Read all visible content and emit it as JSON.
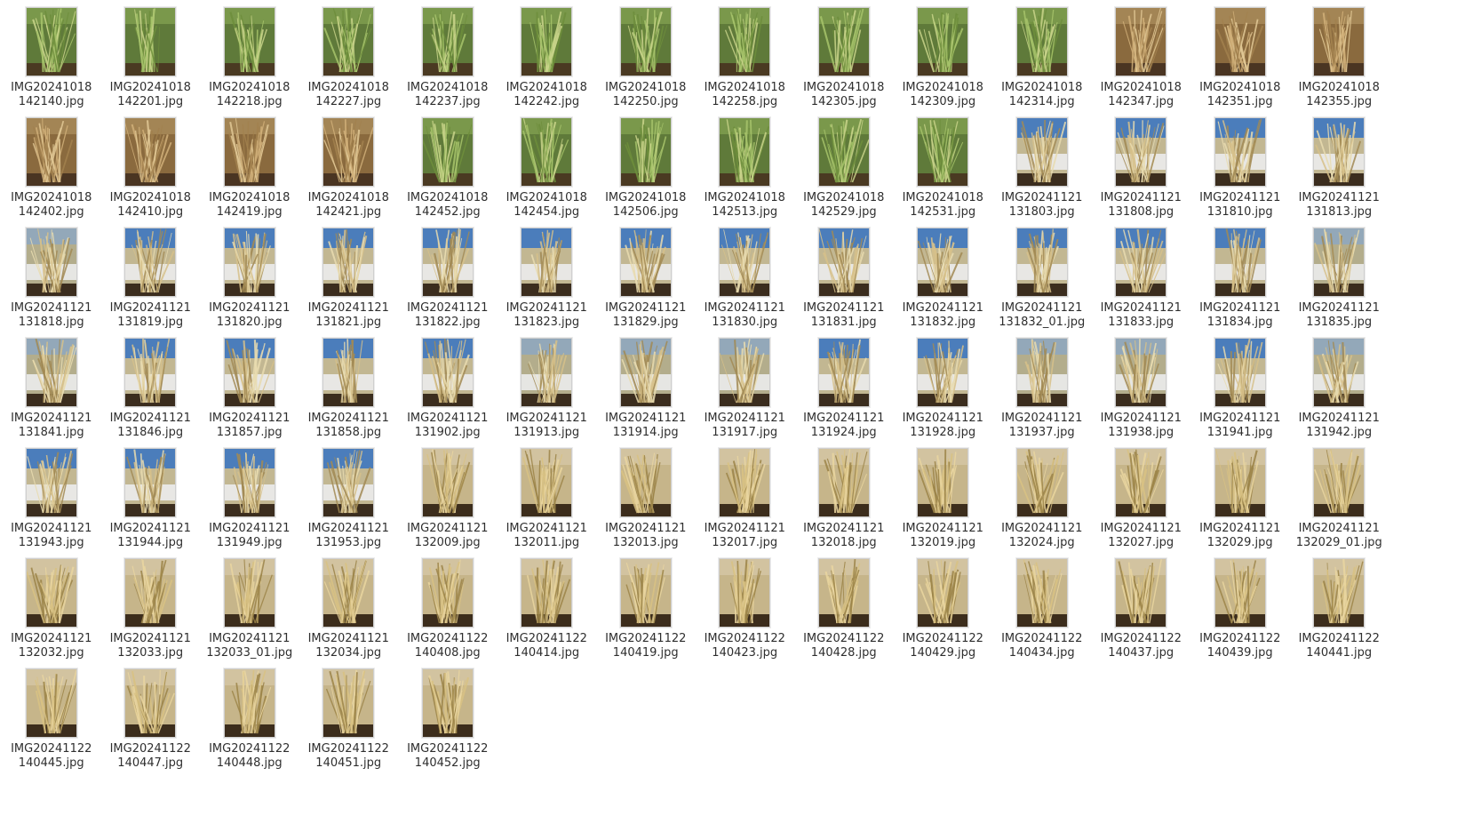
{
  "files": [
    {
      "line1": "IMG20241018",
      "line2": "142140.jpg",
      "style": "green"
    },
    {
      "line1": "IMG20241018",
      "line2": "142201.jpg",
      "style": "green"
    },
    {
      "line1": "IMG20241018",
      "line2": "142218.jpg",
      "style": "green"
    },
    {
      "line1": "IMG20241018",
      "line2": "142227.jpg",
      "style": "green"
    },
    {
      "line1": "IMG20241018",
      "line2": "142237.jpg",
      "style": "green"
    },
    {
      "line1": "IMG20241018",
      "line2": "142242.jpg",
      "style": "green"
    },
    {
      "line1": "IMG20241018",
      "line2": "142250.jpg",
      "style": "green"
    },
    {
      "line1": "IMG20241018",
      "line2": "142258.jpg",
      "style": "green"
    },
    {
      "line1": "IMG20241018",
      "line2": "142305.jpg",
      "style": "green"
    },
    {
      "line1": "IMG20241018",
      "line2": "142309.jpg",
      "style": "green"
    },
    {
      "line1": "IMG20241018",
      "line2": "142314.jpg",
      "style": "green"
    },
    {
      "line1": "IMG20241018",
      "line2": "142347.jpg",
      "style": "dry"
    },
    {
      "line1": "IMG20241018",
      "line2": "142351.jpg",
      "style": "dry"
    },
    {
      "line1": "IMG20241018",
      "line2": "142355.jpg",
      "style": "dry"
    },
    {
      "line1": "IMG20241018",
      "line2": "142402.jpg",
      "style": "dry"
    },
    {
      "line1": "IMG20241018",
      "line2": "142410.jpg",
      "style": "dry"
    },
    {
      "line1": "IMG20241018",
      "line2": "142419.jpg",
      "style": "dry"
    },
    {
      "line1": "IMG20241018",
      "line2": "142421.jpg",
      "style": "dry"
    },
    {
      "line1": "IMG20241018",
      "line2": "142452.jpg",
      "style": "green"
    },
    {
      "line1": "IMG20241018",
      "line2": "142454.jpg",
      "style": "green"
    },
    {
      "line1": "IMG20241018",
      "line2": "142506.jpg",
      "style": "green"
    },
    {
      "line1": "IMG20241018",
      "line2": "142513.jpg",
      "style": "green"
    },
    {
      "line1": "IMG20241018",
      "line2": "142529.jpg",
      "style": "green"
    },
    {
      "line1": "IMG20241018",
      "line2": "142531.jpg",
      "style": "green"
    },
    {
      "line1": "IMG20241121",
      "line2": "131803.jpg",
      "style": "snowsky"
    },
    {
      "line1": "IMG20241121",
      "line2": "131808.jpg",
      "style": "snowsky"
    },
    {
      "line1": "IMG20241121",
      "line2": "131810.jpg",
      "style": "snowsky"
    },
    {
      "line1": "IMG20241121",
      "line2": "131813.jpg",
      "style": "snowsky"
    },
    {
      "line1": "IMG20241121",
      "line2": "131818.jpg",
      "style": "snow"
    },
    {
      "line1": "IMG20241121",
      "line2": "131819.jpg",
      "style": "snowsky"
    },
    {
      "line1": "IMG20241121",
      "line2": "131820.jpg",
      "style": "snowsky"
    },
    {
      "line1": "IMG20241121",
      "line2": "131821.jpg",
      "style": "snowsky"
    },
    {
      "line1": "IMG20241121",
      "line2": "131822.jpg",
      "style": "snowsky"
    },
    {
      "line1": "IMG20241121",
      "line2": "131823.jpg",
      "style": "snowsky"
    },
    {
      "line1": "IMG20241121",
      "line2": "131829.jpg",
      "style": "snowsky"
    },
    {
      "line1": "IMG20241121",
      "line2": "131830.jpg",
      "style": "snowsky"
    },
    {
      "line1": "IMG20241121",
      "line2": "131831.jpg",
      "style": "snowsky"
    },
    {
      "line1": "IMG20241121",
      "line2": "131832.jpg",
      "style": "snowsky"
    },
    {
      "line1": "IMG20241121",
      "line2": "131832_01.jpg",
      "style": "snowsky"
    },
    {
      "line1": "IMG20241121",
      "line2": "131833.jpg",
      "style": "snowsky"
    },
    {
      "line1": "IMG20241121",
      "line2": "131834.jpg",
      "style": "snowsky"
    },
    {
      "line1": "IMG20241121",
      "line2": "131835.jpg",
      "style": "snow"
    },
    {
      "line1": "IMG20241121",
      "line2": "131841.jpg",
      "style": "snow"
    },
    {
      "line1": "IMG20241121",
      "line2": "131846.jpg",
      "style": "snowsky"
    },
    {
      "line1": "IMG20241121",
      "line2": "131857.jpg",
      "style": "snowsky"
    },
    {
      "line1": "IMG20241121",
      "line2": "131858.jpg",
      "style": "snowsky"
    },
    {
      "line1": "IMG20241121",
      "line2": "131902.jpg",
      "style": "snowsky"
    },
    {
      "line1": "IMG20241121",
      "line2": "131913.jpg",
      "style": "snow"
    },
    {
      "line1": "IMG20241121",
      "line2": "131914.jpg",
      "style": "snow"
    },
    {
      "line1": "IMG20241121",
      "line2": "131917.jpg",
      "style": "snow"
    },
    {
      "line1": "IMG20241121",
      "line2": "131924.jpg",
      "style": "snowsky"
    },
    {
      "line1": "IMG20241121",
      "line2": "131928.jpg",
      "style": "snowsky"
    },
    {
      "line1": "IMG20241121",
      "line2": "131937.jpg",
      "style": "snow"
    },
    {
      "line1": "IMG20241121",
      "line2": "131938.jpg",
      "style": "snow"
    },
    {
      "line1": "IMG20241121",
      "line2": "131941.jpg",
      "style": "snowsky"
    },
    {
      "line1": "IMG20241121",
      "line2": "131942.jpg",
      "style": "snow"
    },
    {
      "line1": "IMG20241121",
      "line2": "131943.jpg",
      "style": "snowsky"
    },
    {
      "line1": "IMG20241121",
      "line2": "131944.jpg",
      "style": "snowsky"
    },
    {
      "line1": "IMG20241121",
      "line2": "131949.jpg",
      "style": "snowsky"
    },
    {
      "line1": "IMG20241121",
      "line2": "131953.jpg",
      "style": "snowsky"
    },
    {
      "line1": "IMG20241121",
      "line2": "132009.jpg",
      "style": "wall"
    },
    {
      "line1": "IMG20241121",
      "line2": "132011.jpg",
      "style": "wall"
    },
    {
      "line1": "IMG20241121",
      "line2": "132013.jpg",
      "style": "wall"
    },
    {
      "line1": "IMG20241121",
      "line2": "132017.jpg",
      "style": "wall"
    },
    {
      "line1": "IMG20241121",
      "line2": "132018.jpg",
      "style": "wall"
    },
    {
      "line1": "IMG20241121",
      "line2": "132019.jpg",
      "style": "wall"
    },
    {
      "line1": "IMG20241121",
      "line2": "132024.jpg",
      "style": "wall"
    },
    {
      "line1": "IMG20241121",
      "line2": "132027.jpg",
      "style": "wall"
    },
    {
      "line1": "IMG20241121",
      "line2": "132029.jpg",
      "style": "wall"
    },
    {
      "line1": "IMG20241121",
      "line2": "132029_01.jpg",
      "style": "wall"
    },
    {
      "line1": "IMG20241121",
      "line2": "132032.jpg",
      "style": "wall"
    },
    {
      "line1": "IMG20241121",
      "line2": "132033.jpg",
      "style": "wall"
    },
    {
      "line1": "IMG20241121",
      "line2": "132033_01.jpg",
      "style": "wall"
    },
    {
      "line1": "IMG20241121",
      "line2": "132034.jpg",
      "style": "wall"
    },
    {
      "line1": "IMG20241122",
      "line2": "140408.jpg",
      "style": "wall"
    },
    {
      "line1": "IMG20241122",
      "line2": "140414.jpg",
      "style": "wall"
    },
    {
      "line1": "IMG20241122",
      "line2": "140419.jpg",
      "style": "wall"
    },
    {
      "line1": "IMG20241122",
      "line2": "140423.jpg",
      "style": "wall"
    },
    {
      "line1": "IMG20241122",
      "line2": "140428.jpg",
      "style": "wall"
    },
    {
      "line1": "IMG20241122",
      "line2": "140429.jpg",
      "style": "wall"
    },
    {
      "line1": "IMG20241122",
      "line2": "140434.jpg",
      "style": "wall"
    },
    {
      "line1": "IMG20241122",
      "line2": "140437.jpg",
      "style": "wall"
    },
    {
      "line1": "IMG20241122",
      "line2": "140439.jpg",
      "style": "wall"
    },
    {
      "line1": "IMG20241122",
      "line2": "140441.jpg",
      "style": "wall"
    },
    {
      "line1": "IMG20241122",
      "line2": "140445.jpg",
      "style": "wall"
    },
    {
      "line1": "IMG20241122",
      "line2": "140447.jpg",
      "style": "wall"
    },
    {
      "line1": "IMG20241122",
      "line2": "140448.jpg",
      "style": "wall"
    },
    {
      "line1": "IMG20241122",
      "line2": "140451.jpg",
      "style": "wall"
    },
    {
      "line1": "IMG20241122",
      "line2": "140452.jpg",
      "style": "wall"
    }
  ],
  "colors": {
    "green": {
      "bg": "#5f7a3a",
      "top": "#8fb05a",
      "ground": "#4a3a22",
      "blades": [
        "#a7c46b",
        "#6e8e3c",
        "#c9d48a"
      ]
    },
    "dry": {
      "bg": "#8a6a3e",
      "top": "#b89a68",
      "ground": "#4a3522",
      "blades": [
        "#d1b079",
        "#a2814e",
        "#e2c996"
      ]
    },
    "snowsky": {
      "bg": "#c2b792",
      "top": "#3e77c0",
      "ground": "#3b2d1e",
      "blades": [
        "#d7c18a",
        "#a28a54",
        "#e9dcb0"
      ]
    },
    "snow": {
      "bg": "#b3ad8c",
      "top": "#8fa7be",
      "ground": "#3b2d1e",
      "blades": [
        "#d7c18a",
        "#a28a54",
        "#e9dcb0"
      ]
    },
    "wall": {
      "bg": "#c6b58a",
      "top": "#d3c4a2",
      "ground": "#3c2d1c",
      "blades": [
        "#d9c283",
        "#9c8448",
        "#ead6a0"
      ]
    }
  }
}
